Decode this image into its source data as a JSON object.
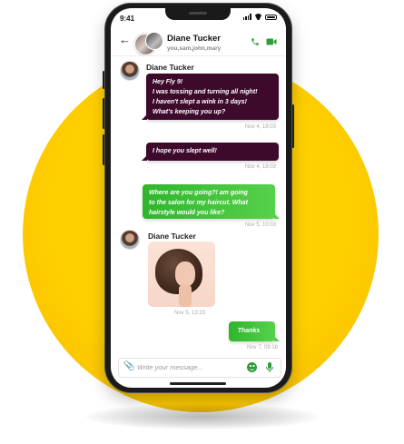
{
  "status_bar": {
    "time": "9:41"
  },
  "header": {
    "back_icon": "arrow-left-icon",
    "name": "Diane Tucker",
    "members": "you,sam,john,mary",
    "call_icon": "phone-icon",
    "video_icon": "video-camera-icon",
    "accent": "#2e9d3a"
  },
  "messages": [
    {
      "sender": "Diane Tucker",
      "type": "incoming",
      "lines": [
        "Hey Fly 9!",
        "I was tossing and turning all night!",
        "I haven't slept a wink in 3 days!",
        "What's keeping you up?"
      ],
      "time": "Nov 4, 18:03"
    },
    {
      "type": "incoming",
      "lines": [
        "I hope you slept well!"
      ],
      "time": "Nov 4, 18:03"
    },
    {
      "type": "outgoing",
      "lines": [
        "Where are you going?! am going",
        "to the salon for my haircut. What",
        "hairstyle would you like?"
      ],
      "time": "Nov 5, 10:03"
    },
    {
      "sender": "Diane Tucker",
      "type": "incoming-image",
      "image": "woman-bob-haircut-photo",
      "time": "Nov 5, 13:23"
    },
    {
      "type": "outgoing",
      "lines": [
        "Thanks"
      ],
      "time": "Nov 7, 09:18"
    }
  ],
  "composer": {
    "placeholder": "Write your message...",
    "attach_icon": "paperclip-icon",
    "emoji_icon": "smiley-icon",
    "mic_icon": "microphone-icon"
  },
  "colors": {
    "incoming_bubble": "#3d0a2c",
    "outgoing_bubble": "#4cc444",
    "background_circle": "#ffd200"
  }
}
